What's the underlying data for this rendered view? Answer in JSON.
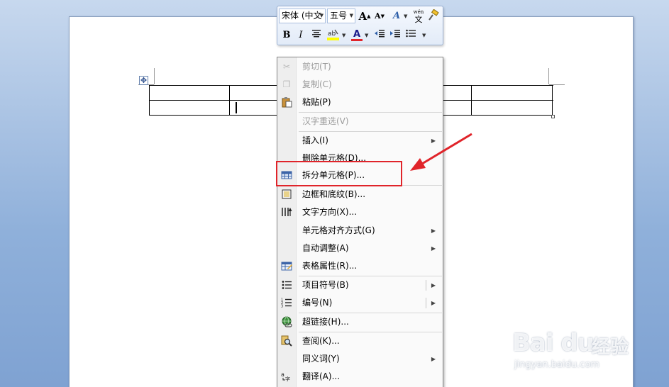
{
  "mini_toolbar": {
    "font_name": "宋体 (中文",
    "font_size": "五号",
    "grow_font_icon": "A",
    "shrink_font_icon": "A",
    "bold_label": "B",
    "italic_label": "I",
    "font_color_label": "A"
  },
  "context_menu": {
    "items": [
      {
        "label": "剪切(T)",
        "icon": "scissors-icon"
      },
      {
        "label": "复制(C)",
        "icon": "copy-icon"
      },
      {
        "label": "粘贴(P)",
        "icon": "paste-icon"
      },
      {
        "label": "汉字重选(V)"
      },
      {
        "label": "插入(I)"
      },
      {
        "label": "删除单元格(D)..."
      },
      {
        "label": "拆分单元格(P)...",
        "icon": "split-cells-icon"
      },
      {
        "label": "边框和底纹(B)...",
        "icon": "borders-icon"
      },
      {
        "label": "文字方向(X)...",
        "icon": "text-direction-icon"
      },
      {
        "label": "单元格对齐方式(G)"
      },
      {
        "label": "自动调整(A)"
      },
      {
        "label": "表格属性(R)...",
        "icon": "table-properties-icon"
      },
      {
        "label": "项目符号(B)",
        "icon": "bullets-icon"
      },
      {
        "label": "编号(N)",
        "icon": "numbering-icon"
      },
      {
        "label": "超链接(H)...",
        "icon": "hyperlink-icon"
      },
      {
        "label": "查阅(K)...",
        "icon": "research-icon"
      },
      {
        "label": "同义词(Y)"
      },
      {
        "label": "翻译(A)...",
        "icon": "translate-icon"
      }
    ]
  },
  "watermark": {
    "logo": "Bai du",
    "brand_cn": "经验",
    "url": "jingyan.baidu.com"
  },
  "colors": {
    "highlight_box": "#e0242a",
    "arrow": "#e0242a",
    "menu_text": "#000000",
    "menu_disabled_text": "#9b9b9b"
  }
}
